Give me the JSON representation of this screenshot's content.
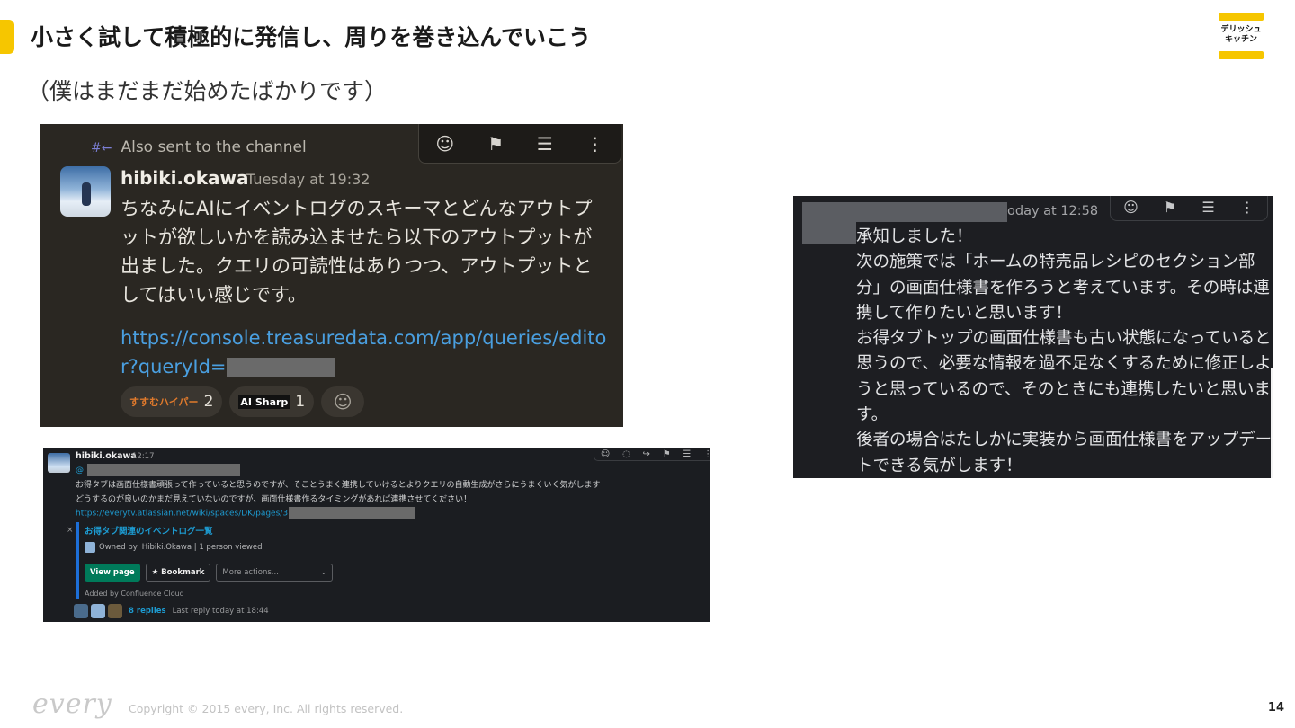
{
  "slide": {
    "title": "小さく試して積極的に発信し、周りを巻き込んでいこう",
    "subtitle": "（僕はまだまだ始めたばかりです）",
    "brand_logo": "デリッシュ キッチン",
    "accent_color": "#f6c600"
  },
  "shot1": {
    "also_sent": "Also sent to the channel",
    "user": "hibiki.okawa",
    "time": "Tuesday at 19:32",
    "message": "ちなみにAIにイベントログのスキーマとどんなアウトプットが欲しいかを読み込ませたら以下のアウトプットが出ました。クエリの可読性はありつつ、アウトプットとしてはいい感じです。",
    "link": "https://console.treasuredata.com/app/queries/editor?queryId=",
    "reactions": [
      {
        "emoji": "すすむハイパー",
        "count": "2"
      },
      {
        "emoji": "AI Sharp",
        "count": "1"
      }
    ],
    "toolbar_icons": [
      "add-reaction-icon",
      "bookmark-icon",
      "forward-icon",
      "more-icon"
    ]
  },
  "shot2": {
    "user": "hibiki.okawa",
    "time": "12:17",
    "mention_prefix": "@",
    "line1": "お得タブは画面仕様書頑張って作っていると思うのですが、そことうまく連携していけるとよりクエリの自動生成がさらにうまくいく気がします",
    "line2": "どうするのが良いのかまだ見えていないのですが、画面仕様書作るタイミングがあれば連携させてください！",
    "url": "https://everytv.atlassian.net/wiki/spaces/DK/pages/3",
    "card_title": "お得タブ関連のイベントログ一覧",
    "owner": "Owned by: Hibiki.Okawa | 1 person viewed",
    "view_page": "View page",
    "bookmark": "★ Bookmark",
    "more_actions": "More actions...",
    "added_by": "Added by Confluence Cloud",
    "replies": "8 replies",
    "last_reply": "Last reply today at 18:44"
  },
  "shot3": {
    "time": "oday at 12:58",
    "message": "承知しました！\n次の施策では「ホームの特売品レシピのセクション部分」の画面仕様書を作ろうと考えています。その時は連携して作りたいと思います！\nお得タブトップの画面仕様書も古い状態になっていると思うので、必要な情報を過不足なくするために修正しようと思っているので、そのときにも連携したいと思います。\n後者の場合はたしかに実装から画面仕様書をアップデートできる気がします！"
  },
  "footer": {
    "logo": "every",
    "copyright": "Copyright © 2015 every, Inc. All rights reserved.",
    "page": "14"
  }
}
